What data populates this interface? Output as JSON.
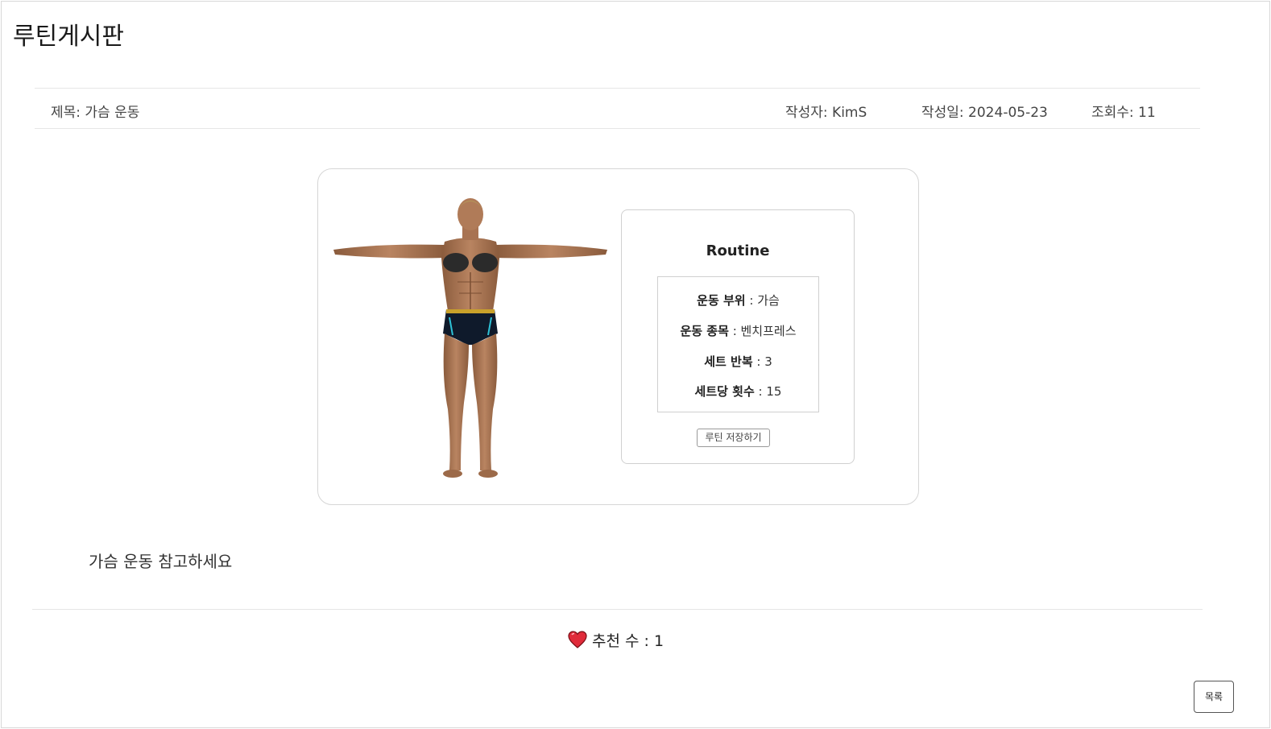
{
  "board": {
    "title": "루틴게시판"
  },
  "post": {
    "title": "제목: 가슴 운동",
    "author": "작성자: KimS",
    "date": "작성일: 2024-05-23",
    "views": "조회수: 11",
    "content": "가슴 운동 참고하세요"
  },
  "routine": {
    "heading": "Routine",
    "items": [
      {
        "label": "운동 부위",
        "value": " : 가슴"
      },
      {
        "label": "운동 종목",
        "value": " : 벤치프레스"
      },
      {
        "label": "세트 반복",
        "value": " : 3"
      },
      {
        "label": "세트당 횟수",
        "value": " : 15"
      }
    ],
    "save_label": "루틴 저장하기"
  },
  "recommend": {
    "label": "추천 수 : 1",
    "icon": "heart-icon",
    "icon_color": "#e02b3a"
  },
  "footer": {
    "list_label": "목록"
  },
  "body_figure": {
    "highlight_part": "가슴",
    "highlight_color": "#2b2b2b"
  }
}
